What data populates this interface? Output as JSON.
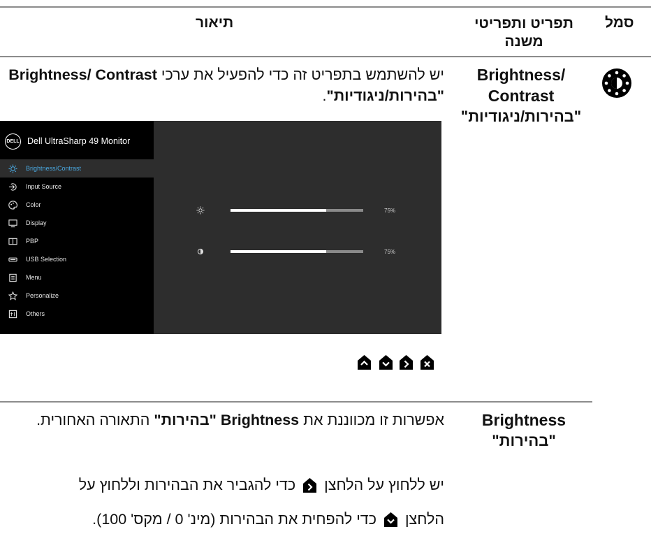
{
  "header": {
    "col_icon": "סמל",
    "col_menu": "תפריט ותפריטי משנה",
    "col_desc": "תיאור"
  },
  "row1": {
    "menu_en": "Brightness/ Contrast",
    "menu_he": "\"בהירות/ניגודיות\"",
    "desc_prefix": "יש להשתמש בתפריט זה כדי להפעיל את ערכי ",
    "desc_bold1": "Brightness/ Contrast",
    "desc_bold2": "\"בהירות/ניגודיות\"",
    "desc_suffix": "."
  },
  "osd": {
    "logo": "DELL",
    "title": "Dell UltraSharp 49 Monitor",
    "items": [
      {
        "label": "Brightness/Contrast",
        "icon": "brightness-icon"
      },
      {
        "label": "Input Source",
        "icon": "input-source-icon"
      },
      {
        "label": "Color",
        "icon": "color-icon"
      },
      {
        "label": "Display",
        "icon": "display-icon"
      },
      {
        "label": "PBP",
        "icon": "pbp-icon"
      },
      {
        "label": "USB Selection",
        "icon": "usb-icon"
      },
      {
        "label": "Menu",
        "icon": "menu-icon"
      },
      {
        "label": "Personalize",
        "icon": "star-icon"
      },
      {
        "label": "Others",
        "icon": "others-icon"
      }
    ],
    "brightness_value": "75%",
    "contrast_value": "75%",
    "brightness_level": 0.72,
    "contrast_level": 0.72
  },
  "row2": {
    "menu_en": "Brightness",
    "menu_he": "\"בהירות\"",
    "p1_prefix": "אפשרות זו מכווננת את ",
    "p1_bold": "Brightness \"בהירות\"",
    "p1_suffix": " התאורה האחורית.",
    "p2_a": "יש ללחוץ על הלחצן",
    "p2_b": "כדי להגביר את הבהירות וללחוץ על",
    "p3_a": "הלחצן",
    "p3_b": "כדי להפחית את הבהירות (מינ' 0 / מקס' 100)."
  },
  "colors": {
    "osd_bg": "#000000",
    "osd_panel": "#2d2d2d",
    "osd_accent": "#4aa8e0",
    "button_fill": "#000000"
  }
}
